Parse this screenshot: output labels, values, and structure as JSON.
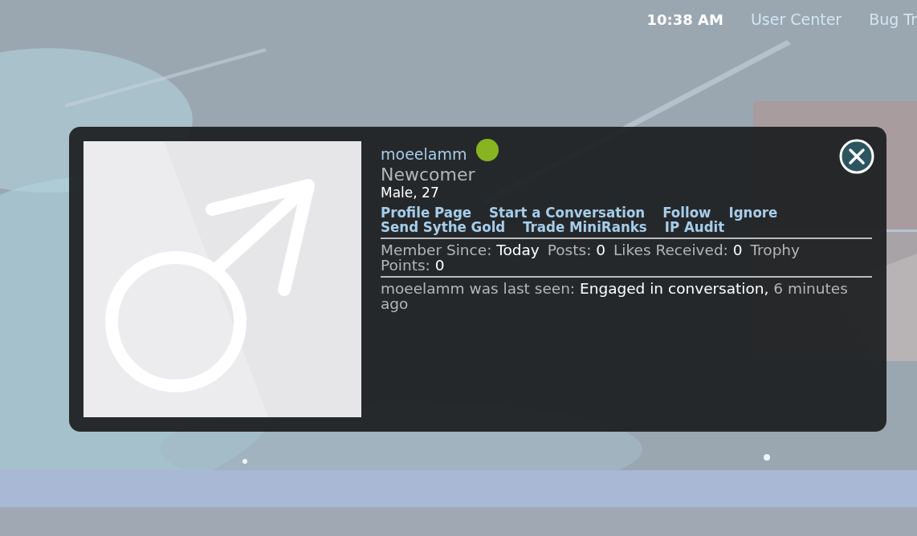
{
  "top_bar": {
    "time": "10:38 AM",
    "links": [
      "User Center",
      "Bug Tr"
    ]
  },
  "profile_card": {
    "username": "moeelamm",
    "online": true,
    "rank": "Newcomer",
    "info": "Male, 27",
    "actions": [
      [
        "Profile Page",
        "Start a Conversation",
        "Follow",
        "Ignore"
      ],
      [
        "Send Sythe Gold",
        "Trade MiniRanks",
        "IP Audit"
      ]
    ],
    "stats": [
      {
        "label": "Member Since:",
        "value": "Today"
      },
      {
        "label": "Posts:",
        "value": "0"
      },
      {
        "label": "Likes Received:",
        "value": "0"
      },
      {
        "label": "Trophy Points:",
        "value": "0"
      }
    ],
    "last_seen": "moeelamm was last seen: **Engaged in conversation,** 6 minutes ago"
  }
}
